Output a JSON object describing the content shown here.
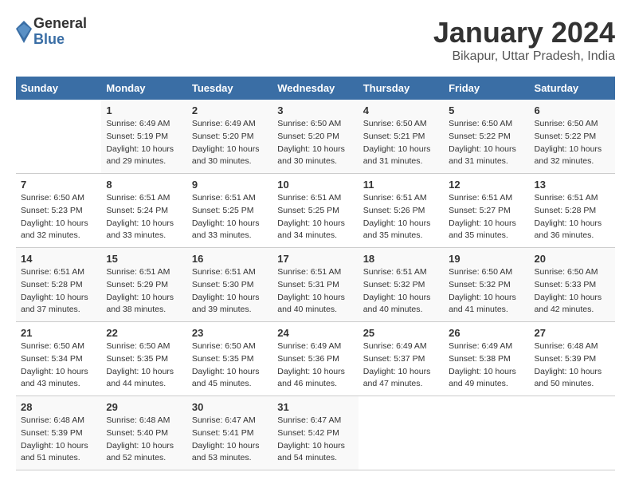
{
  "logo": {
    "general": "General",
    "blue": "Blue"
  },
  "title": "January 2024",
  "subtitle": "Bikapur, Uttar Pradesh, India",
  "headers": [
    "Sunday",
    "Monday",
    "Tuesday",
    "Wednesday",
    "Thursday",
    "Friday",
    "Saturday"
  ],
  "weeks": [
    [
      {
        "day": "",
        "sunrise": "",
        "sunset": "",
        "daylight": ""
      },
      {
        "day": "1",
        "sunrise": "Sunrise: 6:49 AM",
        "sunset": "Sunset: 5:19 PM",
        "daylight": "Daylight: 10 hours and 29 minutes."
      },
      {
        "day": "2",
        "sunrise": "Sunrise: 6:49 AM",
        "sunset": "Sunset: 5:20 PM",
        "daylight": "Daylight: 10 hours and 30 minutes."
      },
      {
        "day": "3",
        "sunrise": "Sunrise: 6:50 AM",
        "sunset": "Sunset: 5:20 PM",
        "daylight": "Daylight: 10 hours and 30 minutes."
      },
      {
        "day": "4",
        "sunrise": "Sunrise: 6:50 AM",
        "sunset": "Sunset: 5:21 PM",
        "daylight": "Daylight: 10 hours and 31 minutes."
      },
      {
        "day": "5",
        "sunrise": "Sunrise: 6:50 AM",
        "sunset": "Sunset: 5:22 PM",
        "daylight": "Daylight: 10 hours and 31 minutes."
      },
      {
        "day": "6",
        "sunrise": "Sunrise: 6:50 AM",
        "sunset": "Sunset: 5:22 PM",
        "daylight": "Daylight: 10 hours and 32 minutes."
      }
    ],
    [
      {
        "day": "7",
        "sunrise": "Sunrise: 6:50 AM",
        "sunset": "Sunset: 5:23 PM",
        "daylight": "Daylight: 10 hours and 32 minutes."
      },
      {
        "day": "8",
        "sunrise": "Sunrise: 6:51 AM",
        "sunset": "Sunset: 5:24 PM",
        "daylight": "Daylight: 10 hours and 33 minutes."
      },
      {
        "day": "9",
        "sunrise": "Sunrise: 6:51 AM",
        "sunset": "Sunset: 5:25 PM",
        "daylight": "Daylight: 10 hours and 33 minutes."
      },
      {
        "day": "10",
        "sunrise": "Sunrise: 6:51 AM",
        "sunset": "Sunset: 5:25 PM",
        "daylight": "Daylight: 10 hours and 34 minutes."
      },
      {
        "day": "11",
        "sunrise": "Sunrise: 6:51 AM",
        "sunset": "Sunset: 5:26 PM",
        "daylight": "Daylight: 10 hours and 35 minutes."
      },
      {
        "day": "12",
        "sunrise": "Sunrise: 6:51 AM",
        "sunset": "Sunset: 5:27 PM",
        "daylight": "Daylight: 10 hours and 35 minutes."
      },
      {
        "day": "13",
        "sunrise": "Sunrise: 6:51 AM",
        "sunset": "Sunset: 5:28 PM",
        "daylight": "Daylight: 10 hours and 36 minutes."
      }
    ],
    [
      {
        "day": "14",
        "sunrise": "Sunrise: 6:51 AM",
        "sunset": "Sunset: 5:28 PM",
        "daylight": "Daylight: 10 hours and 37 minutes."
      },
      {
        "day": "15",
        "sunrise": "Sunrise: 6:51 AM",
        "sunset": "Sunset: 5:29 PM",
        "daylight": "Daylight: 10 hours and 38 minutes."
      },
      {
        "day": "16",
        "sunrise": "Sunrise: 6:51 AM",
        "sunset": "Sunset: 5:30 PM",
        "daylight": "Daylight: 10 hours and 39 minutes."
      },
      {
        "day": "17",
        "sunrise": "Sunrise: 6:51 AM",
        "sunset": "Sunset: 5:31 PM",
        "daylight": "Daylight: 10 hours and 40 minutes."
      },
      {
        "day": "18",
        "sunrise": "Sunrise: 6:51 AM",
        "sunset": "Sunset: 5:32 PM",
        "daylight": "Daylight: 10 hours and 40 minutes."
      },
      {
        "day": "19",
        "sunrise": "Sunrise: 6:50 AM",
        "sunset": "Sunset: 5:32 PM",
        "daylight": "Daylight: 10 hours and 41 minutes."
      },
      {
        "day": "20",
        "sunrise": "Sunrise: 6:50 AM",
        "sunset": "Sunset: 5:33 PM",
        "daylight": "Daylight: 10 hours and 42 minutes."
      }
    ],
    [
      {
        "day": "21",
        "sunrise": "Sunrise: 6:50 AM",
        "sunset": "Sunset: 5:34 PM",
        "daylight": "Daylight: 10 hours and 43 minutes."
      },
      {
        "day": "22",
        "sunrise": "Sunrise: 6:50 AM",
        "sunset": "Sunset: 5:35 PM",
        "daylight": "Daylight: 10 hours and 44 minutes."
      },
      {
        "day": "23",
        "sunrise": "Sunrise: 6:50 AM",
        "sunset": "Sunset: 5:35 PM",
        "daylight": "Daylight: 10 hours and 45 minutes."
      },
      {
        "day": "24",
        "sunrise": "Sunrise: 6:49 AM",
        "sunset": "Sunset: 5:36 PM",
        "daylight": "Daylight: 10 hours and 46 minutes."
      },
      {
        "day": "25",
        "sunrise": "Sunrise: 6:49 AM",
        "sunset": "Sunset: 5:37 PM",
        "daylight": "Daylight: 10 hours and 47 minutes."
      },
      {
        "day": "26",
        "sunrise": "Sunrise: 6:49 AM",
        "sunset": "Sunset: 5:38 PM",
        "daylight": "Daylight: 10 hours and 49 minutes."
      },
      {
        "day": "27",
        "sunrise": "Sunrise: 6:48 AM",
        "sunset": "Sunset: 5:39 PM",
        "daylight": "Daylight: 10 hours and 50 minutes."
      }
    ],
    [
      {
        "day": "28",
        "sunrise": "Sunrise: 6:48 AM",
        "sunset": "Sunset: 5:39 PM",
        "daylight": "Daylight: 10 hours and 51 minutes."
      },
      {
        "day": "29",
        "sunrise": "Sunrise: 6:48 AM",
        "sunset": "Sunset: 5:40 PM",
        "daylight": "Daylight: 10 hours and 52 minutes."
      },
      {
        "day": "30",
        "sunrise": "Sunrise: 6:47 AM",
        "sunset": "Sunset: 5:41 PM",
        "daylight": "Daylight: 10 hours and 53 minutes."
      },
      {
        "day": "31",
        "sunrise": "Sunrise: 6:47 AM",
        "sunset": "Sunset: 5:42 PM",
        "daylight": "Daylight: 10 hours and 54 minutes."
      },
      {
        "day": "",
        "sunrise": "",
        "sunset": "",
        "daylight": ""
      },
      {
        "day": "",
        "sunrise": "",
        "sunset": "",
        "daylight": ""
      },
      {
        "day": "",
        "sunrise": "",
        "sunset": "",
        "daylight": ""
      }
    ]
  ]
}
